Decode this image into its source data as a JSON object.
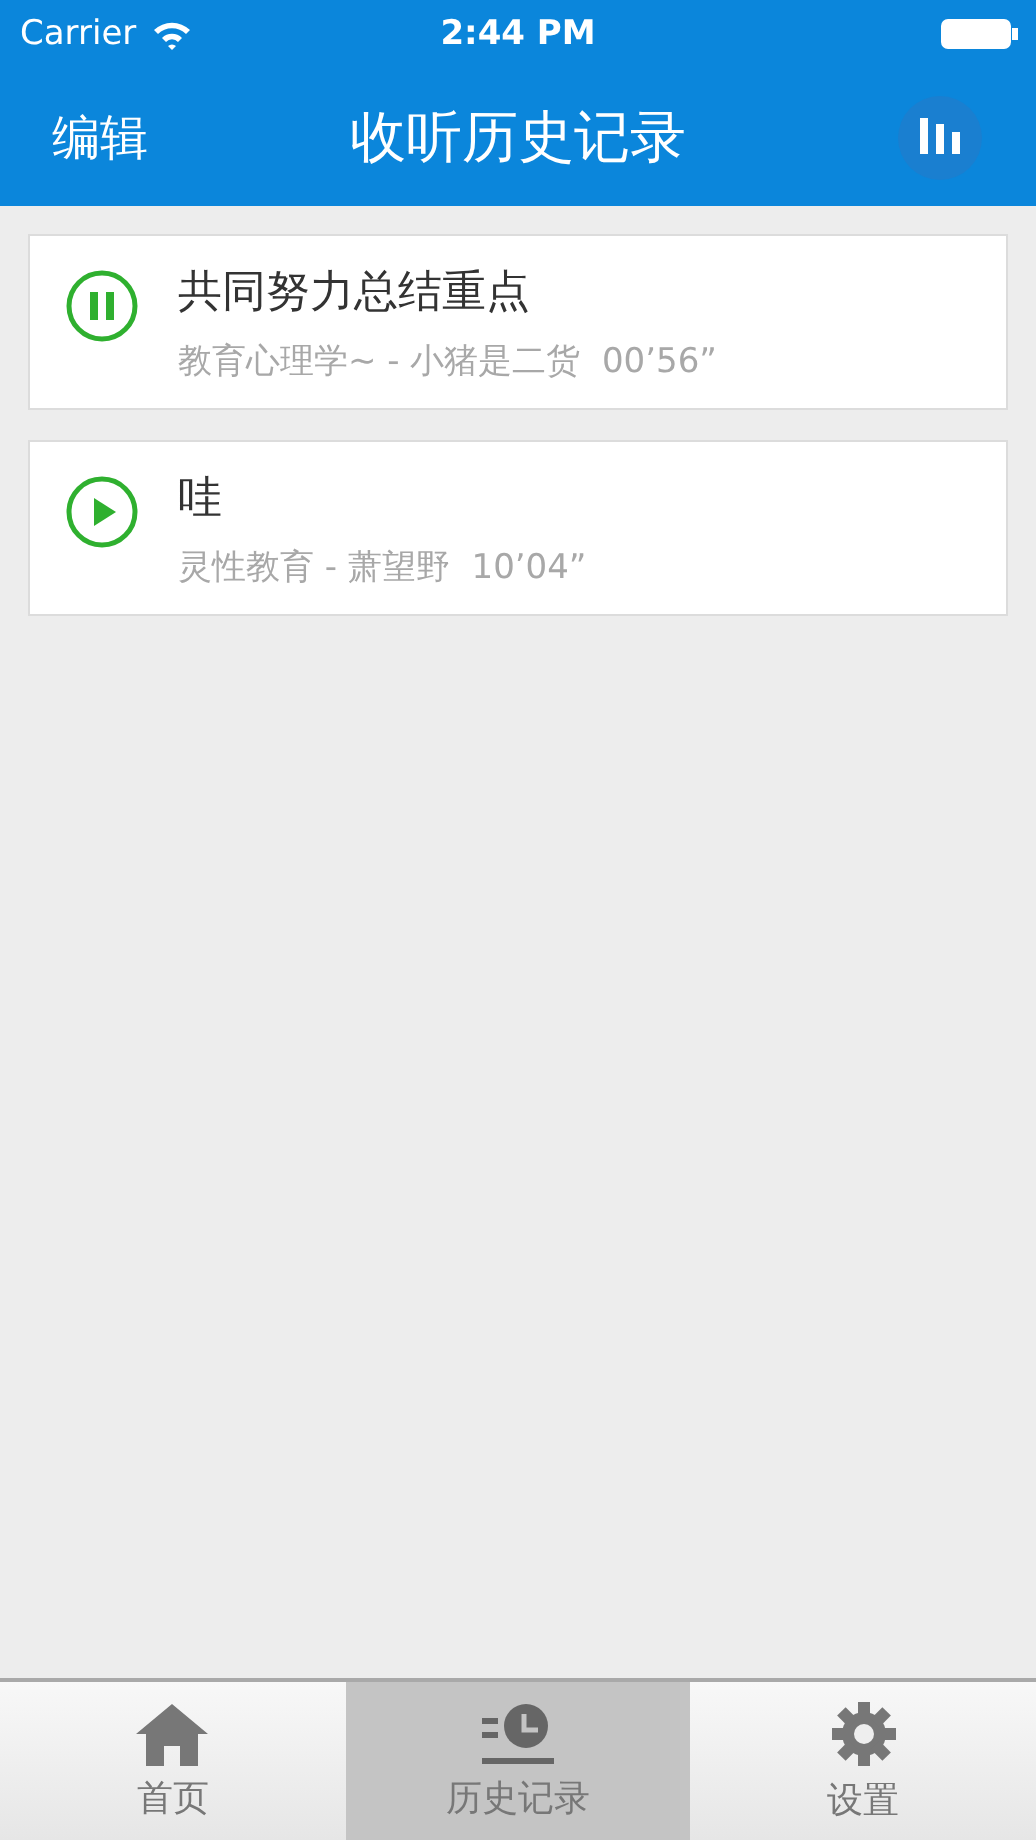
{
  "status_bar": {
    "carrier": "Carrier",
    "time": "2:44 PM"
  },
  "nav_bar": {
    "left_button": "编辑",
    "title": "收听历史记录"
  },
  "history": [
    {
      "title": "共同努力总结重点",
      "subtitle": "教育心理学~ - 小猪是二货  00’56”",
      "playing": true
    },
    {
      "title": "哇",
      "subtitle": "灵性教育 - 萧望野  10’04”",
      "playing": false
    }
  ],
  "tabs": [
    {
      "label": "首页",
      "kind": "home",
      "selected": false
    },
    {
      "label": "历史记录",
      "kind": "history",
      "selected": true
    },
    {
      "label": "设置",
      "kind": "settings",
      "selected": false
    }
  ]
}
